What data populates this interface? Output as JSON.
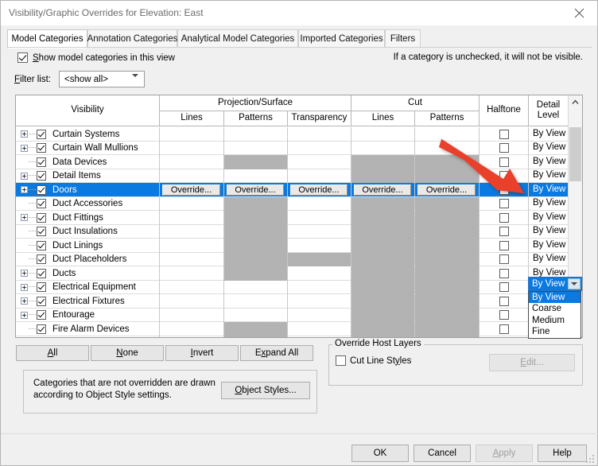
{
  "window": {
    "title": "Visibility/Graphic Overrides for Elevation: East",
    "close_icon": "close-icon"
  },
  "tabs": [
    {
      "label": "Model Categories",
      "active": true
    },
    {
      "label": "Annotation Categories",
      "active": false
    },
    {
      "label": "Analytical Model Categories",
      "active": false
    },
    {
      "label": "Imported Categories",
      "active": false
    },
    {
      "label": "Filters",
      "active": false
    }
  ],
  "options": {
    "show_model_categories_label": "Show model categories in this view",
    "show_model_categories_checked": true,
    "hint": "If a category is unchecked, it will not be visible.",
    "filter_list_label": "Filter list:",
    "filter_list_value": "<show all>",
    "filter_list_options": [
      "<show all>"
    ]
  },
  "table": {
    "header": {
      "visibility": "Visibility",
      "projection_surface": "Projection/Surface",
      "cut": "Cut",
      "halftone": "Halftone",
      "detail_level": "Detail Level",
      "sub": {
        "ps_lines": "Lines",
        "ps_patterns": "Patterns",
        "ps_transparency": "Transparency",
        "cut_lines": "Lines",
        "cut_patterns": "Patterns"
      }
    },
    "override_label": "Override...",
    "detail_level_default": "By View",
    "rows": [
      {
        "name": "Curtain Systems",
        "expandable": true,
        "checked": true,
        "detail": "By View",
        "shaded": []
      },
      {
        "name": "Curtain Wall Mullions",
        "expandable": true,
        "checked": true,
        "detail": "By View",
        "shaded": []
      },
      {
        "name": "Data Devices",
        "expandable": false,
        "checked": true,
        "detail": "By View",
        "shaded": [
          "ps_patterns",
          "cut_lines",
          "cut_patterns"
        ]
      },
      {
        "name": "Detail Items",
        "expandable": true,
        "checked": true,
        "detail": "By View",
        "shaded": [
          "cut_lines",
          "cut_patterns"
        ]
      },
      {
        "name": "Doors",
        "expandable": true,
        "checked": true,
        "detail": "By View",
        "shaded": [],
        "selected": true
      },
      {
        "name": "Duct Accessories",
        "expandable": false,
        "checked": true,
        "detail": "By View",
        "shaded": [
          "ps_patterns",
          "cut_lines",
          "cut_patterns"
        ]
      },
      {
        "name": "Duct Fittings",
        "expandable": true,
        "checked": true,
        "detail": "By View",
        "shaded": [
          "ps_patterns",
          "cut_lines",
          "cut_patterns"
        ]
      },
      {
        "name": "Duct Insulations",
        "expandable": false,
        "checked": true,
        "detail": "By View",
        "shaded": [
          "ps_patterns",
          "cut_lines",
          "cut_patterns"
        ]
      },
      {
        "name": "Duct Linings",
        "expandable": false,
        "checked": true,
        "detail": "By View",
        "shaded": [
          "ps_patterns",
          "cut_lines",
          "cut_patterns"
        ]
      },
      {
        "name": "Duct Placeholders",
        "expandable": false,
        "checked": true,
        "detail": "By View",
        "shaded": [
          "ps_patterns",
          "ps_transparency",
          "cut_lines",
          "cut_patterns"
        ]
      },
      {
        "name": "Ducts",
        "expandable": true,
        "checked": true,
        "detail": "By View",
        "shaded": [
          "ps_patterns",
          "cut_lines",
          "cut_patterns"
        ]
      },
      {
        "name": "Electrical Equipment",
        "expandable": true,
        "checked": true,
        "detail": "By View",
        "shaded": [
          "cut_lines",
          "cut_patterns"
        ]
      },
      {
        "name": "Electrical Fixtures",
        "expandable": true,
        "checked": true,
        "detail": "By View",
        "shaded": [
          "cut_lines",
          "cut_patterns"
        ]
      },
      {
        "name": "Entourage",
        "expandable": true,
        "checked": true,
        "detail": "By View",
        "shaded": [
          "cut_lines",
          "cut_patterns"
        ]
      },
      {
        "name": "Fire Alarm Devices",
        "expandable": false,
        "checked": true,
        "detail": "By View",
        "shaded": [
          "ps_patterns",
          "cut_lines",
          "cut_patterns"
        ]
      }
    ],
    "scrollbar": {
      "up_icon": "chevron-up-icon",
      "down_icon": "chevron-down-icon"
    }
  },
  "detail_dropdown": {
    "selected": "By View",
    "items": [
      "By View",
      "Coarse",
      "Medium",
      "Fine"
    ]
  },
  "selection_buttons": {
    "all": "All",
    "none": "None",
    "invert": "Invert",
    "expand_all": "Expand All"
  },
  "note": {
    "line1": "Categories that are not overridden are drawn",
    "line2": "according to Object Style settings.",
    "object_styles_button": "Object Styles..."
  },
  "override_host_layers": {
    "title": "Override Host Layers",
    "cut_line_styles_label": "Cut Line Styles",
    "cut_line_styles_checked": false,
    "edit_button": "Edit...",
    "edit_enabled": false
  },
  "footer": {
    "ok": "OK",
    "cancel": "Cancel",
    "apply": "Apply",
    "apply_enabled": false,
    "help": "Help"
  },
  "annotation": {
    "arrow_color": "#e8402a",
    "arrow_name": "red-pointer-arrow"
  },
  "colors": {
    "selection_blue": "#0a7ae0",
    "dialog_bg": "#f0f0f0",
    "shade_gray": "#c8c8c8"
  }
}
